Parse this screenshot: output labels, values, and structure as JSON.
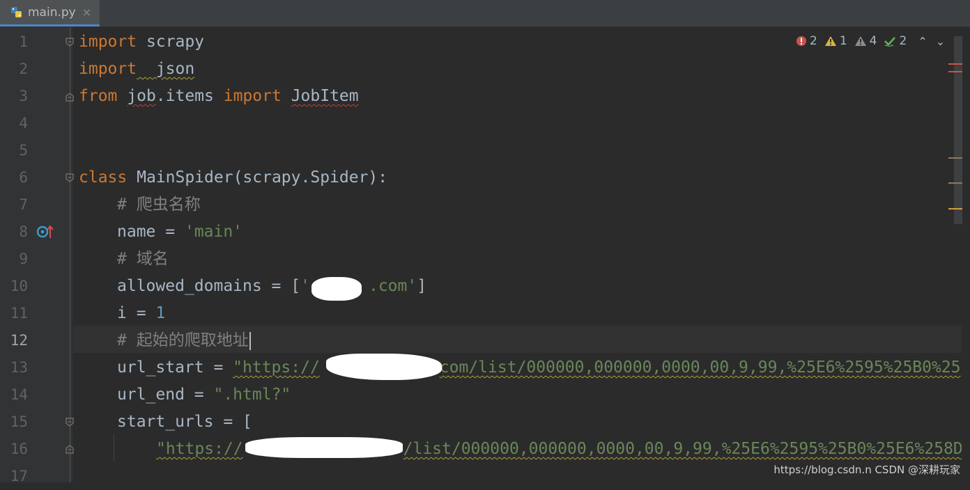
{
  "tab": {
    "filename": "main.py",
    "close_glyph": "×"
  },
  "inspections": {
    "errors": "2",
    "warnings": "1",
    "weak_warnings": "4",
    "typos": "2",
    "prev_glyph": "⌃",
    "next_glyph": "⌄"
  },
  "line_numbers": [
    "1",
    "2",
    "3",
    "4",
    "5",
    "6",
    "7",
    "8",
    "9",
    "10",
    "11",
    "12",
    "13",
    "14",
    "15",
    "16",
    "17"
  ],
  "code": {
    "l1": {
      "kw": "import",
      "rest": " scrapy"
    },
    "l2": {
      "kw": "import",
      "rest": "  json"
    },
    "l3": {
      "kw_from": "from",
      "module": "job",
      "dot_items": ".items ",
      "kw_import": "import",
      "cls": "JobItem"
    },
    "l6": {
      "kw": "class",
      "rest": " MainSpider(scrapy.Spider):"
    },
    "l7": {
      "comment": "# 爬虫名称"
    },
    "l8": {
      "name": "name = ",
      "value": "'main'"
    },
    "l9": {
      "comment": "# 域名"
    },
    "l10": {
      "lhs": "allowed_domains = [",
      "str_open": "'",
      "str_rest": ".com'",
      "close": "]"
    },
    "l11": {
      "lhs": "i = ",
      "value": "1"
    },
    "l12": {
      "comment": "# 起始的爬取地址"
    },
    "l13": {
      "lhs": "url_start = ",
      "str_head": "\"https://",
      "str_tail": "com/list/000000,000000,0000,00,9,99,%25E6%2595%25B0%25"
    },
    "l14": {
      "lhs": "url_end = ",
      "value": "\".html?\""
    },
    "l15": {
      "lhs": "start_urls = ["
    },
    "l16": {
      "str_head": "\"https://",
      "str_tail": "/list/000000,000000,0000,00,9,99,%25E6%2595%25B0%25E6%258D"
    }
  },
  "watermark": "https://blog.csdn.n CSDN @深耕玩家",
  "colors": {
    "background": "#2b2b2b",
    "keyword": "#cc7832",
    "string": "#6a8759",
    "number": "#6897bb",
    "comment": "#808080",
    "identifier": "#a9b7c6",
    "tab_accent": "#4a88c7"
  }
}
